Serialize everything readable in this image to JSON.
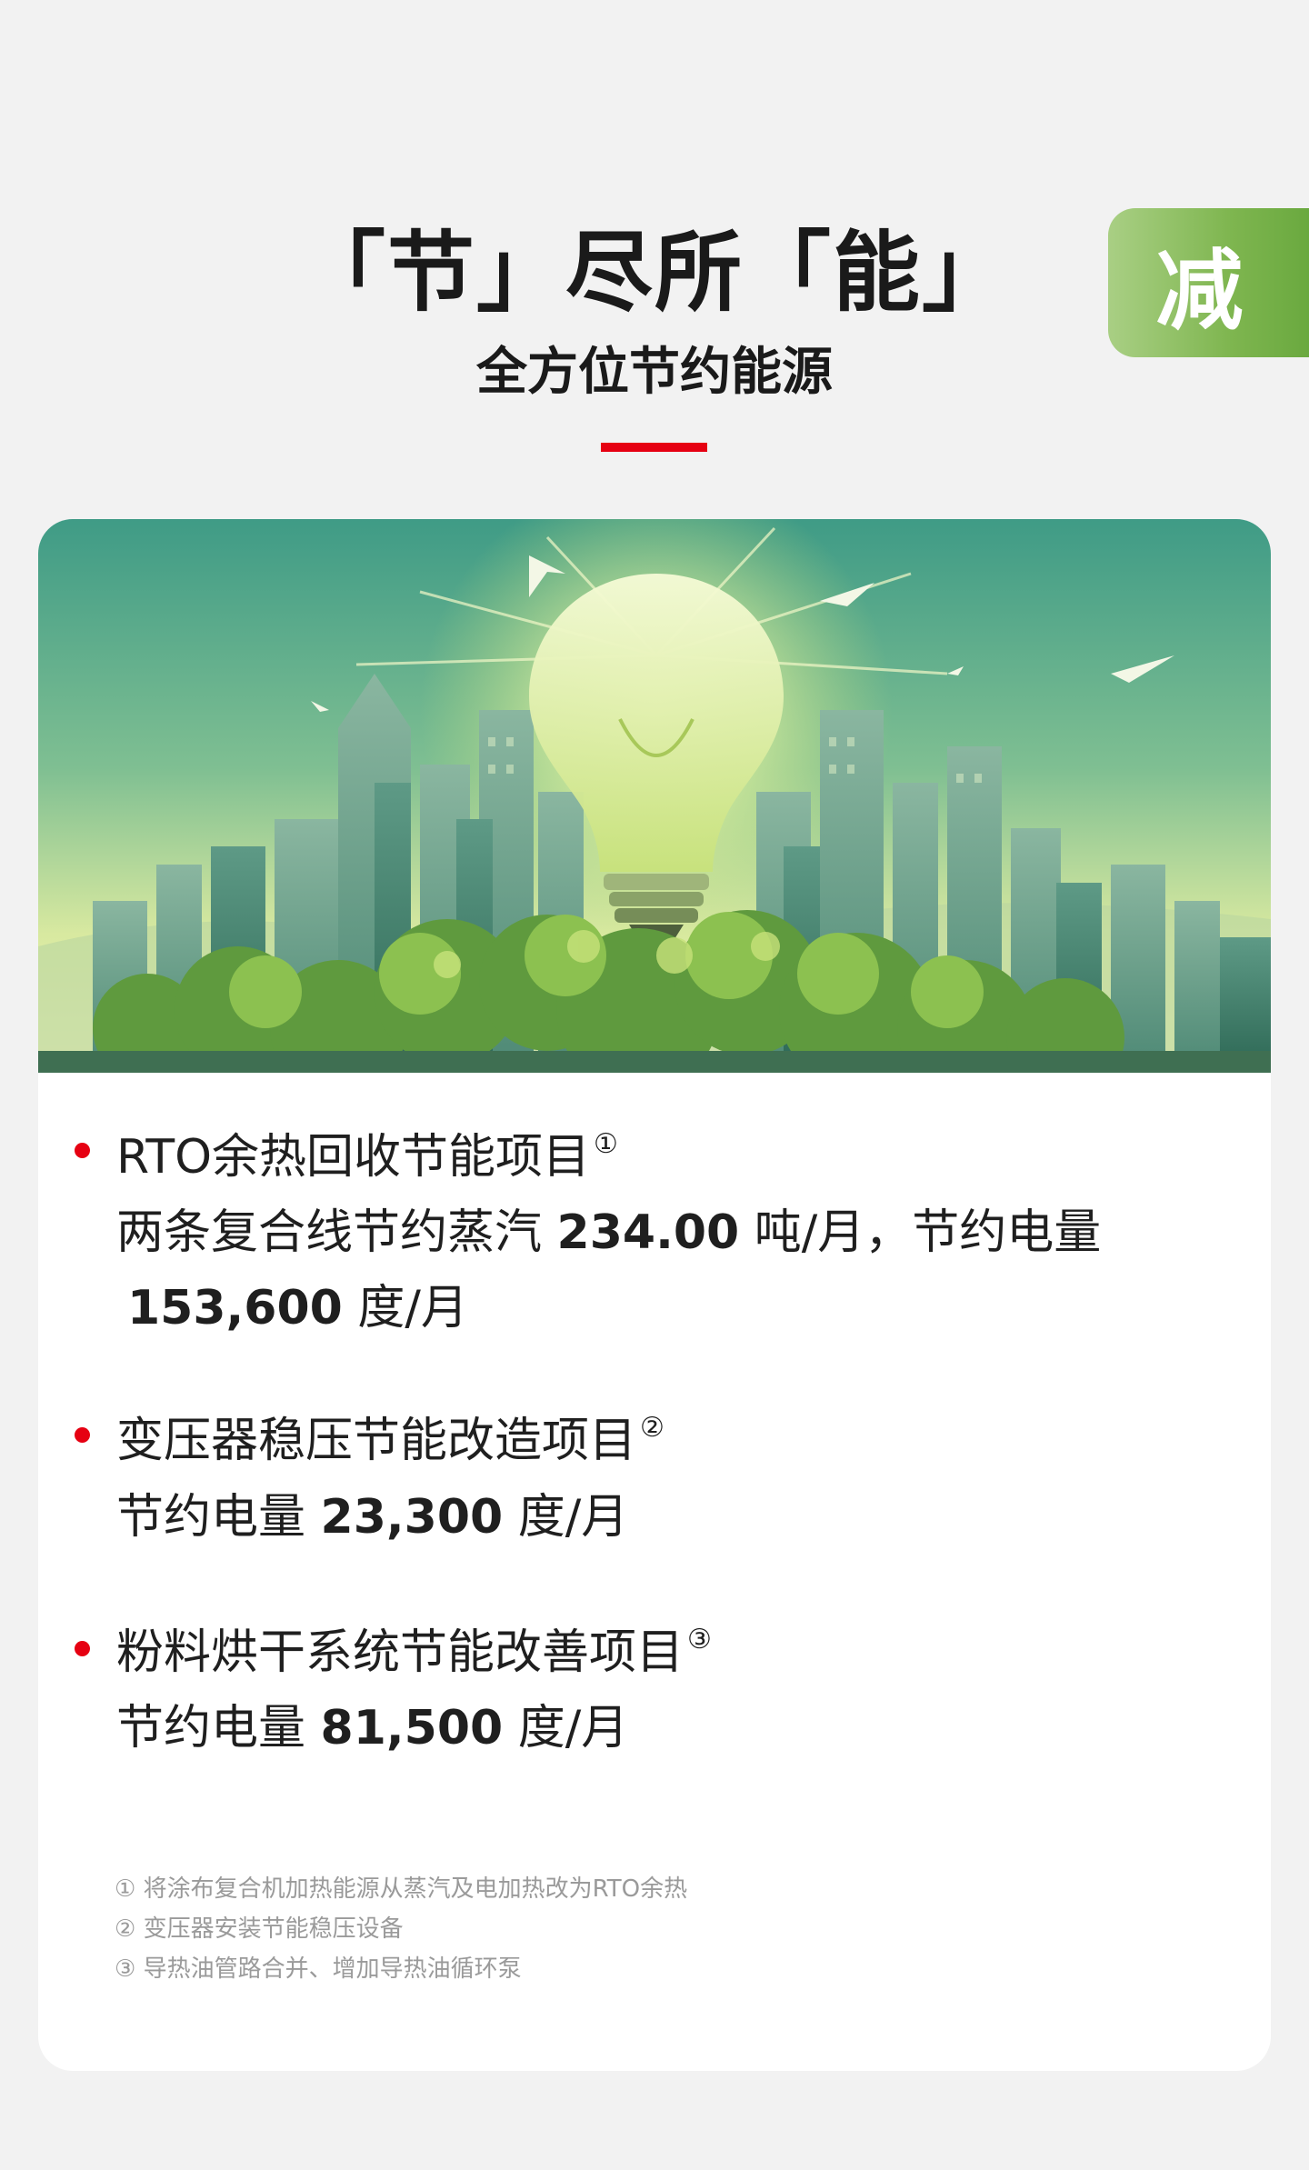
{
  "header": {
    "title": "「节」尽所「能」",
    "subtitle": "全方位节约能源",
    "tab_label": "减"
  },
  "items": [
    {
      "title": "RTO余热回收节能项目",
      "marker": "①",
      "line1_pre": "两条复合线节约蒸汽",
      "line1_value": "234.00",
      "line1_post": "吨/月，节约电量",
      "line2_value": "153,600",
      "line2_post": "度/月"
    },
    {
      "title": "变压器稳压节能改造项目",
      "marker": "②",
      "line1_pre": "节约电量",
      "line1_value": "23,300",
      "line1_post": "度/月"
    },
    {
      "title": "粉料烘干系统节能改善项目",
      "marker": "③",
      "line1_pre": "节约电量",
      "line1_value": "81,500",
      "line1_post": "度/月"
    }
  ],
  "footnotes": [
    "① 将涂布复合机加热能源从蒸汽及电加热改为RTO余热",
    "② 变压器安装节能稳压设备",
    "③ 导热油管路合并、增加导热油循环泵"
  ],
  "colors": {
    "accent_red": "#e60012",
    "tab_green": "#7fb650",
    "page_bg": "#f2f2f2",
    "card_bg": "#ffffff"
  },
  "illustration": {
    "subject": "lightbulb-city-illustration"
  }
}
